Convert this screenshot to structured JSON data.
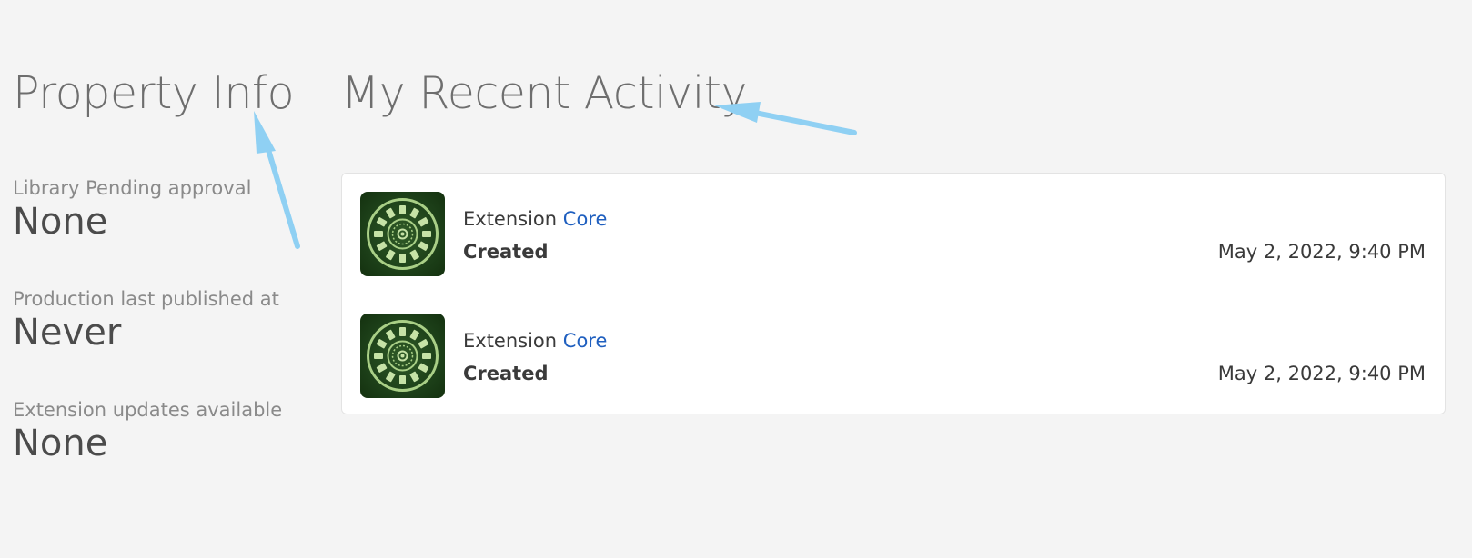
{
  "property_info": {
    "title": "Property Info",
    "items": [
      {
        "label": "Library Pending approval",
        "value": "None"
      },
      {
        "label": "Production last published at",
        "value": "Never"
      },
      {
        "label": "Extension updates available",
        "value": "None"
      }
    ]
  },
  "recent_activity": {
    "title": "My Recent Activity",
    "rows": [
      {
        "icon": "core-extension-icon",
        "entity_type": "Extension",
        "entity_name": "Core",
        "action": "Created",
        "timestamp": "May 2, 2022, 9:40 PM"
      },
      {
        "icon": "core-extension-icon",
        "entity_type": "Extension",
        "entity_name": "Core",
        "action": "Created",
        "timestamp": "May 2, 2022, 9:40 PM"
      }
    ]
  },
  "colors": {
    "background": "#f4f4f4",
    "link": "#1f5fbf",
    "annotation_arrow": "#8fd0f3",
    "icon_background": "#1b3d17",
    "icon_foreground": "#b7d98f"
  }
}
